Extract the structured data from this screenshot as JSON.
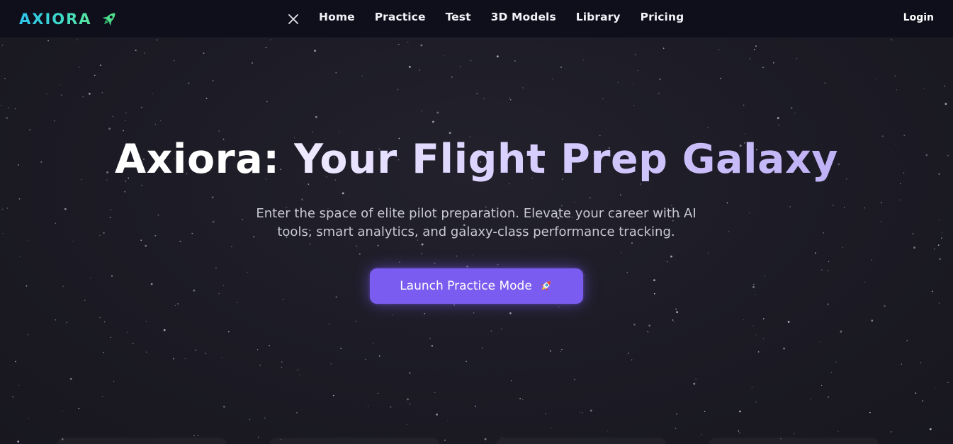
{
  "brand": {
    "name": "AXIORA",
    "icon": "rocket-icon",
    "gradient_colors": [
      "#2fc4ef",
      "#5be59b"
    ]
  },
  "nav": {
    "close_icon": "close-icon",
    "links": [
      "Home",
      "Practice",
      "Test",
      "3D Models",
      "Library",
      "Pricing"
    ],
    "login_label": "Login"
  },
  "hero": {
    "title_part1": "Axiora:",
    "title_part2": "Your Flight Prep Galaxy",
    "subtitle_line1": "Enter the space of elite pilot preparation. Elevate your career with AI",
    "subtitle_line2": "tools, smart analytics, and galaxy-class performance tracking.",
    "cta_label": "Launch Practice Mode",
    "cta_icon": "rocket-emoji-icon"
  },
  "colors": {
    "background": "#1b1b24",
    "navbar": "#0f0f1c",
    "accent": "#7a5cf0",
    "title_gradient_end": "#bfb1f6"
  }
}
